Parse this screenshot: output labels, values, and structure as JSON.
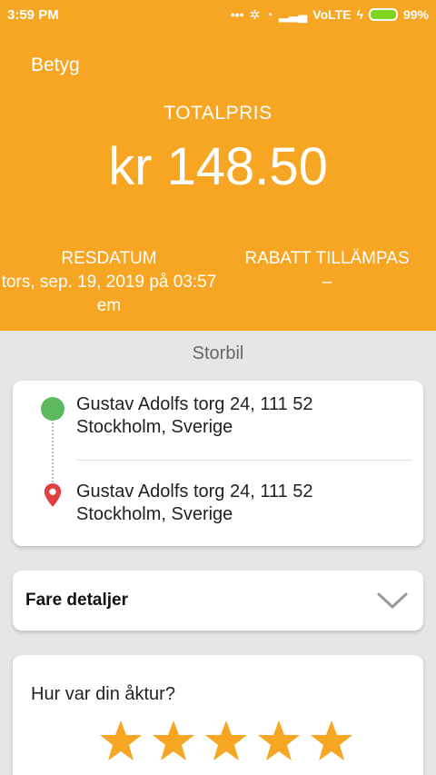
{
  "status_bar": {
    "time": "3:59 PM",
    "network": "VoLTE",
    "battery": "99%"
  },
  "header": {
    "rate_label": "Betyg",
    "total_label": "TOTALPRIS",
    "total_value": "kr 148.50",
    "travel_date_label": "RESDATUM",
    "travel_date_value": "tors, sep. 19, 2019 på 03:57 em",
    "discount_label": "RABATT TILLÄMPAS",
    "discount_value": "–"
  },
  "vehicle_type": "Storbil",
  "route": {
    "pickup": "Gustav Adolfs torg 24, 111 52 Stockholm, Sverige",
    "dropoff": "Gustav Adolfs torg 24, 111 52 Stockholm, Sverige"
  },
  "fare_details": {
    "title": "Fare detaljer"
  },
  "rating": {
    "question": "Hur var din åktur?",
    "stars_filled": 5,
    "stars_total": 5
  },
  "colors": {
    "accent": "#f6a623",
    "pickup": "#5cb85c",
    "dropoff": "#e04040",
    "star": "#f6a623"
  }
}
